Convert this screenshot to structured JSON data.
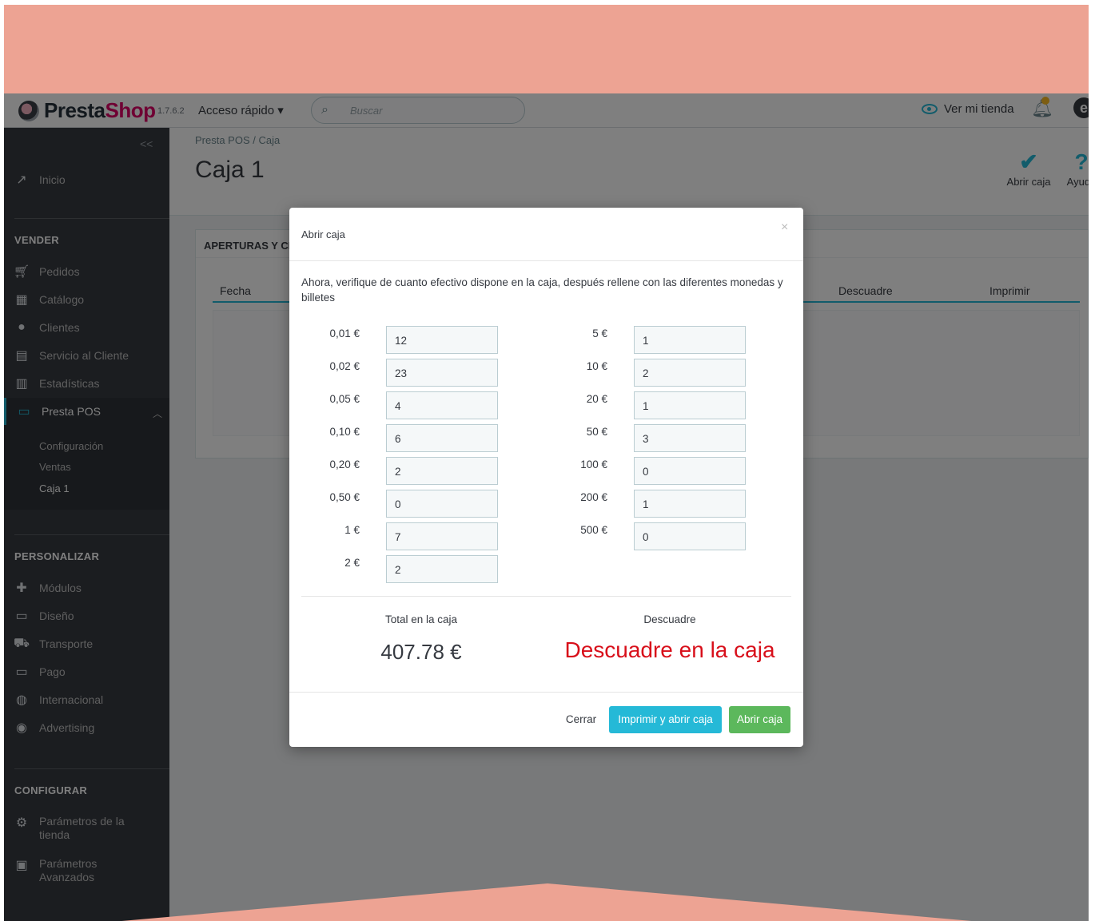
{
  "header": {
    "brand_prefix": "Presta",
    "brand_suffix": "Shop",
    "version": "1.7.6.2",
    "quick_access": "Acceso rápido ▾",
    "search_placeholder": "Buscar",
    "view_store": "Ver mi tienda"
  },
  "sidebar": {
    "collapse": "<<",
    "home": "Inicio",
    "sections": [
      {
        "title": "VENDER",
        "items": [
          "Pedidos",
          "Catálogo",
          "Clientes",
          "Servicio al Cliente",
          "Estadísticas",
          "Presta POS"
        ]
      },
      {
        "title": "PERSONALIZAR",
        "items": [
          "Módulos",
          "Diseño",
          "Transporte",
          "Pago",
          "Internacional",
          "Advertising"
        ]
      },
      {
        "title": "CONFIGURAR",
        "items": [
          "Parámetros de la tienda",
          "Parámetros Avanzados"
        ]
      }
    ],
    "presta_pos_sub": [
      "Configuración",
      "Ventas",
      "Caja 1"
    ]
  },
  "page": {
    "breadcrumb": "Presta POS  /  Caja",
    "title": "Caja 1",
    "toolbar": {
      "open_box": "Abrir caja",
      "help": "Ayuda"
    },
    "panel_title": "APERTURAS Y CIERRES",
    "columns": [
      "Fecha",
      "Descuadre",
      "Imprimir"
    ]
  },
  "modal": {
    "title": "Abrir caja",
    "close_symbol": "×",
    "description": "Ahora, verifique de cuanto efectivo dispone en la caja, después rellene con las diferentes monedas y billetes",
    "coins": [
      {
        "label": "0,01 €",
        "value": "12"
      },
      {
        "label": "0,02 €",
        "value": "23"
      },
      {
        "label": "0,05 €",
        "value": "4"
      },
      {
        "label": "0,10 €",
        "value": "6"
      },
      {
        "label": "0,20 €",
        "value": "2"
      },
      {
        "label": "0,50 €",
        "value": "0"
      },
      {
        "label": "1 €",
        "value": "7"
      },
      {
        "label": "2 €",
        "value": "2"
      }
    ],
    "bills": [
      {
        "label": "5 €",
        "value": "1"
      },
      {
        "label": "10 €",
        "value": "2"
      },
      {
        "label": "20 €",
        "value": "1"
      },
      {
        "label": "50 €",
        "value": "3"
      },
      {
        "label": "100 €",
        "value": "0"
      },
      {
        "label": "200 €",
        "value": "1"
      },
      {
        "label": "500 €",
        "value": "0"
      }
    ],
    "total_label": "Total en la caja",
    "total_value": "407.78 €",
    "mismatch_label": "Descuadre",
    "mismatch_value": "Descuadre en la caja",
    "buttons": {
      "close": "Cerrar",
      "print_open": "Imprimir y abrir caja",
      "open": "Abrir caja"
    }
  },
  "colors": {
    "accent": "#25b9d7",
    "success": "#5cb85c",
    "danger": "#d80f1a",
    "background_frame": "#eda393",
    "sidebar": "#363a41"
  }
}
